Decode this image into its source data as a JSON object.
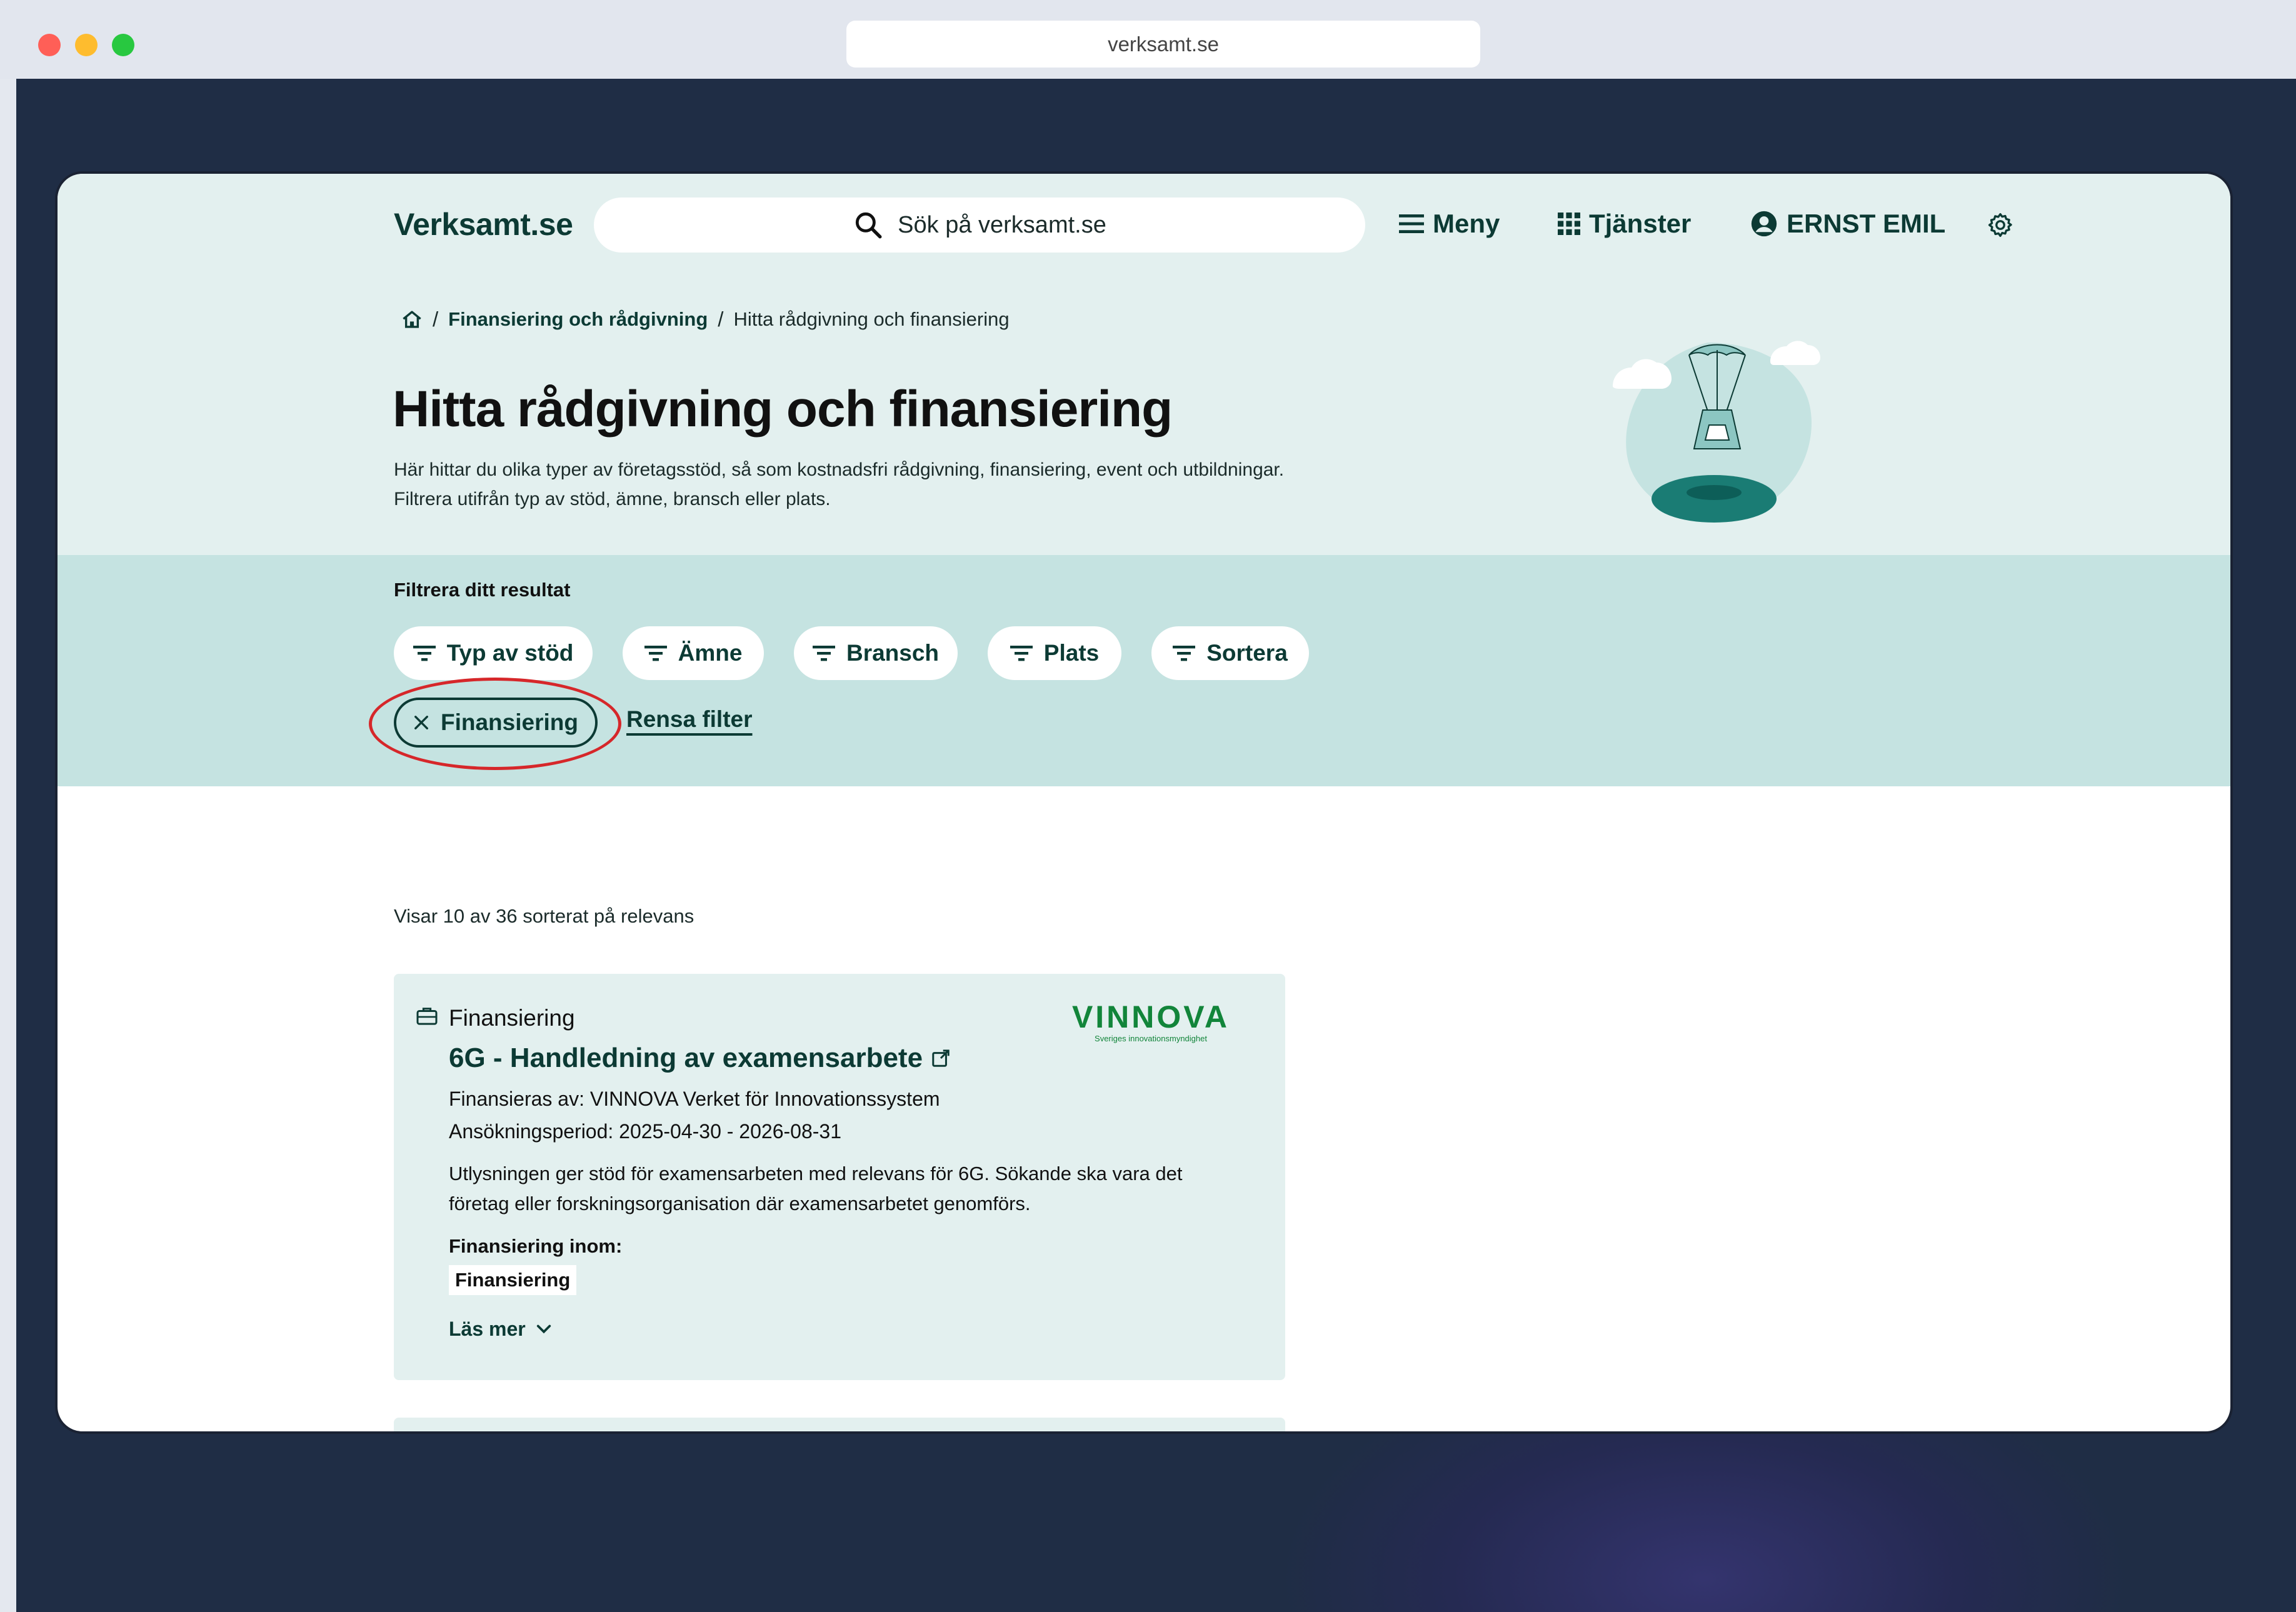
{
  "browser": {
    "url": "verksamt.se"
  },
  "header": {
    "logo": "Verksamt.se",
    "search_placeholder": "Sök på verksamt.se",
    "nav": {
      "menu": "Meny",
      "services": "Tjänster",
      "user": "ERNST EMIL"
    }
  },
  "breadcrumb": {
    "items": [
      "Finansiering och rådgivning",
      "Hitta rådgivning och finansiering"
    ]
  },
  "page": {
    "title": "Hitta rådgivning och finansiering",
    "intro": "Här hittar du olika typer av företagsstöd, så som kostnadsfri rådgivning, finansiering, event och utbildningar. Filtrera utifrån typ av stöd, ämne, bransch eller plats."
  },
  "filters": {
    "heading": "Filtrera ditt resultat",
    "buttons": [
      "Typ av stöd",
      "Ämne",
      "Bransch",
      "Plats",
      "Sortera"
    ],
    "active_chip": "Finansiering",
    "clear_label": "Rensa filter"
  },
  "results": {
    "count_text": "Visar 10 av 36 sorterat på relevans",
    "items": [
      {
        "type": "Finansiering",
        "title": "6G - Handledning av examensarbete",
        "funder": "Finansieras av: VINNOVA Verket för Innovationssystem",
        "period": "Ansökningsperiod: 2025-04-30 - 2026-08-31",
        "description": "Utlysningen ger stöd för examensarbeten med relevans för 6G. Sökande ska vara det företag eller forskningsorganisation där examensarbetet genomförs.",
        "within_label": "Finansiering inom:",
        "tag": "Finansiering",
        "read_more": "Läs mer",
        "logo_word": "VINNOVA",
        "logo_sub": "Sveriges innovationsmyndighet"
      }
    ]
  },
  "colors": {
    "brand_dark": "#0c3a34",
    "hero_bg": "#e3f0ef",
    "filter_bg": "#c5e3e1",
    "highlight": "#d6272a",
    "vinnova_green": "#12853a"
  }
}
